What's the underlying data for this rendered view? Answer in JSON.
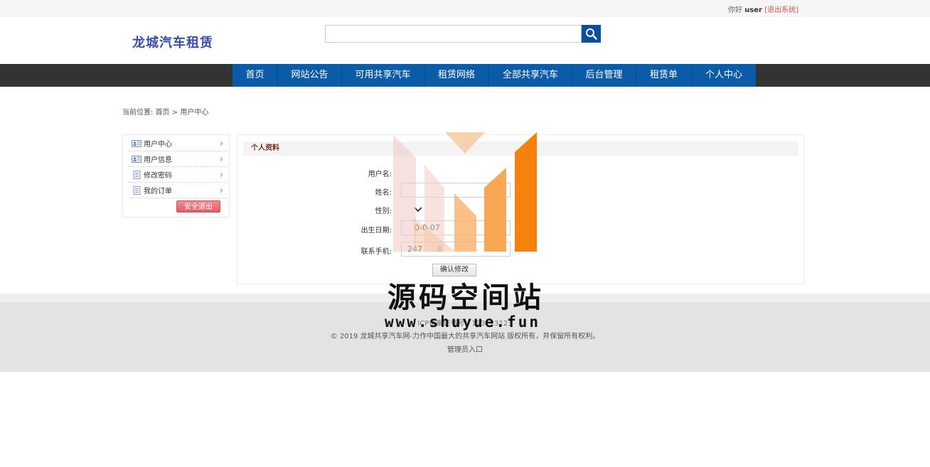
{
  "topbar": {
    "greeting": "你好",
    "username": "user",
    "logout_link": "[退出系统]"
  },
  "header": {
    "logo": "龙城汽车租赁",
    "search": {
      "value": "",
      "placeholder": ""
    }
  },
  "nav": {
    "items": [
      {
        "label": "首页"
      },
      {
        "label": "网站公告"
      },
      {
        "label": "可用共享汽车"
      },
      {
        "label": "租赁网络"
      },
      {
        "label": "全部共享汽车"
      },
      {
        "label": "后台管理"
      },
      {
        "label": "租赁单"
      },
      {
        "label": "个人中心"
      }
    ]
  },
  "breadcrumb": {
    "prefix": "当前位置:",
    "home": "首页",
    "separator": ">",
    "current": "用户中心"
  },
  "sidebar": {
    "items": [
      {
        "label": "用户中心",
        "icon": "user-card-icon"
      },
      {
        "label": "用户信息",
        "icon": "user-card-icon"
      },
      {
        "label": "修改密码",
        "icon": "document-icon"
      },
      {
        "label": "我的订单",
        "icon": "document-icon"
      }
    ],
    "logout_button": "安全退出"
  },
  "profile": {
    "title": "个人资料",
    "fields": {
      "username_label": "用户名:",
      "name_label": "姓名:",
      "gender_label": "性别:",
      "birthday_label": "出生日期:",
      "birthday_value": "0-0-07",
      "phone_label": "联系手机:",
      "phone_value": "247      8"
    },
    "submit": "确认修改"
  },
  "footer": {
    "icp": "ICP备案证书号：123123123",
    "copyright": "© 2019 龙城共享汽车网-力作中国最大的共享汽车网站 版权所有，并保留所有权利。",
    "admin_link": "管理员入口"
  },
  "watermark": {
    "title": "源码空间站",
    "url": "www.shuyue.fun"
  },
  "colors": {
    "nav_bg": "#0b5ba8",
    "nav_bar": "#333333",
    "logo": "#3a4ea8",
    "accent_orange": "#f5820d"
  }
}
